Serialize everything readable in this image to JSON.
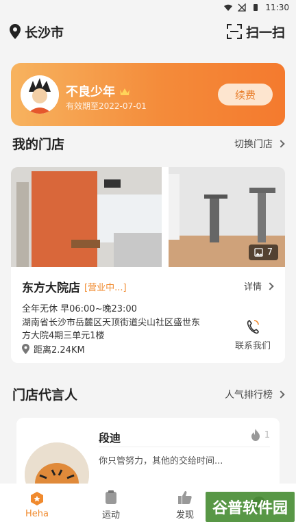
{
  "status_bar": {
    "time": "11:30"
  },
  "header": {
    "city": "长沙市",
    "scan_label": "扫一扫"
  },
  "member": {
    "name": "不良少年",
    "valid_until": "有效期至2022-07-01",
    "renew_label": "续费"
  },
  "my_store_section": {
    "title": "我的门店",
    "switch_label": "切换门店"
  },
  "store": {
    "name": "东方大院店",
    "status": "[营业中...]",
    "detail_label": "详情",
    "hours": "全年无休  早06:00~晚23:00",
    "address": "湖南省长沙市岳麓区天顶街道尖山社区盛世东方大院4期三单元1楼",
    "distance": "距离2.24KM",
    "contact_label": "联系我们",
    "photo_count": "7"
  },
  "spokesperson_section": {
    "title": "门店代言人",
    "ranking_label": "人气排行榜"
  },
  "spokesperson": {
    "name": "段迪",
    "quote": "你只管努力，其他的交给时间...",
    "likes": "1"
  },
  "bottom_nav": [
    {
      "label": "Heha"
    },
    {
      "label": "运动"
    },
    {
      "label": "发现"
    },
    {
      "label": ""
    }
  ],
  "watermark": "谷普软件园",
  "colors": {
    "accent": "#f08a2e",
    "card_gradient_start": "#f7b35f",
    "card_gradient_end": "#f47a2e"
  }
}
